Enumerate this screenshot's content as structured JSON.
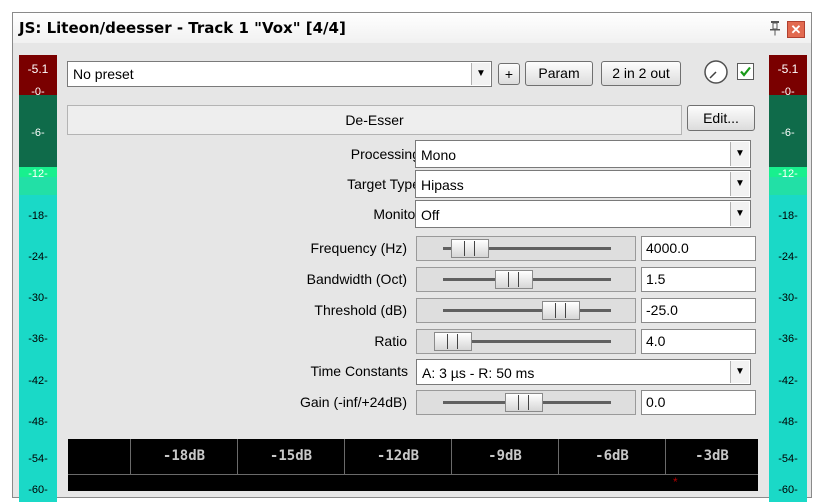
{
  "window": {
    "title": "JS: Liteon/deesser - Track 1 \"Vox\" [4/4]"
  },
  "toolbar": {
    "preset_value": "No preset",
    "add_label": "+",
    "param_label": "Param",
    "io_label": "2 in 2 out",
    "bypass_checked": true
  },
  "header": {
    "plugin_name": "De-Esser",
    "edit_label": "Edit..."
  },
  "meters": {
    "left_peak": "-5.1",
    "right_peak": "-5.1",
    "ticks": [
      "-0-",
      "-6-",
      "-12-",
      "-18-",
      "-24-",
      "-30-",
      "-36-",
      "-42-",
      "-48-",
      "-54-",
      "-60-"
    ]
  },
  "params": {
    "processing": {
      "label": "Processing",
      "value": "Mono"
    },
    "target_type": {
      "label": "Target Type",
      "value": "Hipass"
    },
    "monitor": {
      "label": "Monitor",
      "value": "Off"
    },
    "frequency": {
      "label": "Frequency (Hz)",
      "value": "4000.0",
      "level": 0.18
    },
    "bandwidth": {
      "label": "Bandwidth (Oct)",
      "value": "1.5",
      "level": 0.43
    },
    "threshold": {
      "label": "Threshold (dB)",
      "value": "-25.0",
      "level": 0.7
    },
    "ratio": {
      "label": "Ratio",
      "value": "4.0",
      "level": 0.08
    },
    "time_constants": {
      "label": "Time Constants",
      "value": "A: 3 µs - R: 50 ms"
    },
    "gain": {
      "label": "Gain (-inf/+24dB)",
      "value": "0.0",
      "level": 0.49
    }
  },
  "scope": {
    "labels": [
      "-18dB",
      "-15dB",
      "-12dB",
      "-9dB",
      "-6dB",
      "-3dB"
    ],
    "marker": "*"
  },
  "colors": {
    "meter_bg": "#1ad9c7",
    "meter_peak": "#7a0000",
    "meter_dark": "#0f6b4a",
    "meter_bright": "#18f08e",
    "close_button": "#e26a50",
    "checkbox_check": "#1a9a1a"
  }
}
